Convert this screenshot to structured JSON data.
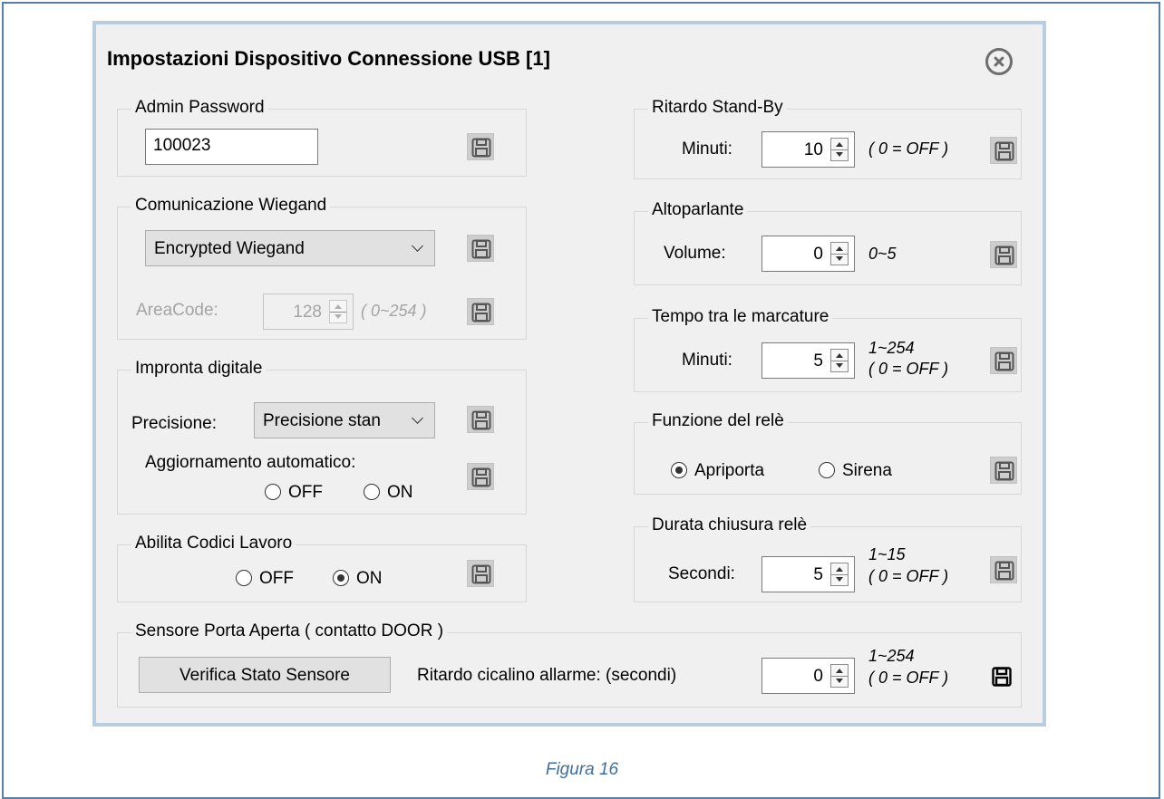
{
  "dialog": {
    "title": "Impostazioni Dispositivo Connessione USB [1]",
    "close_icon": "close-circle-icon"
  },
  "admin_password": {
    "legend": "Admin Password",
    "value": "100023"
  },
  "wiegand": {
    "legend": "Comunicazione Wiegand",
    "mode": "Encrypted Wiegand",
    "areacode_label": "AreaCode:",
    "areacode_value": "128",
    "areacode_hint": "( 0~254 )"
  },
  "fingerprint": {
    "legend": "Impronta digitale",
    "precision_label": "Precisione:",
    "precision_value": "Precisione stan",
    "auto_update_label": "Aggiornamento automatico:",
    "off_label": "OFF",
    "on_label": "ON",
    "selected": "none"
  },
  "work_codes": {
    "legend": "Abilita Codici Lavoro",
    "off_label": "OFF",
    "on_label": "ON",
    "selected": "ON"
  },
  "door_sensor": {
    "legend": "Sensore Porta Aperta ( contatto DOOR )",
    "verify_button": "Verifica Stato Sensore",
    "delay_label": "Ritardo cicalino allarme: (secondi)",
    "delay_value": "0",
    "hint_range": "1~254",
    "hint_off": "( 0 = OFF )"
  },
  "standby": {
    "legend": "Ritardo Stand-By",
    "minutes_label": "Minuti:",
    "value": "10",
    "hint": "( 0 = OFF )"
  },
  "speaker": {
    "legend": "Altoparlante",
    "volume_label": "Volume:",
    "value": "0",
    "hint": "0~5"
  },
  "punch_interval": {
    "legend": "Tempo tra le marcature",
    "minutes_label": "Minuti:",
    "value": "5",
    "hint_range": "1~254",
    "hint_off": "( 0 = OFF )"
  },
  "relay_function": {
    "legend": "Funzione del relè",
    "option1": "Apriporta",
    "option2": "Sirena",
    "selected": "Apriporta"
  },
  "relay_duration": {
    "legend": "Durata chiusura relè",
    "seconds_label": "Secondi:",
    "value": "5",
    "hint_range": "1~15",
    "hint_off": "( 0 = OFF )"
  },
  "caption": "Figura 16"
}
